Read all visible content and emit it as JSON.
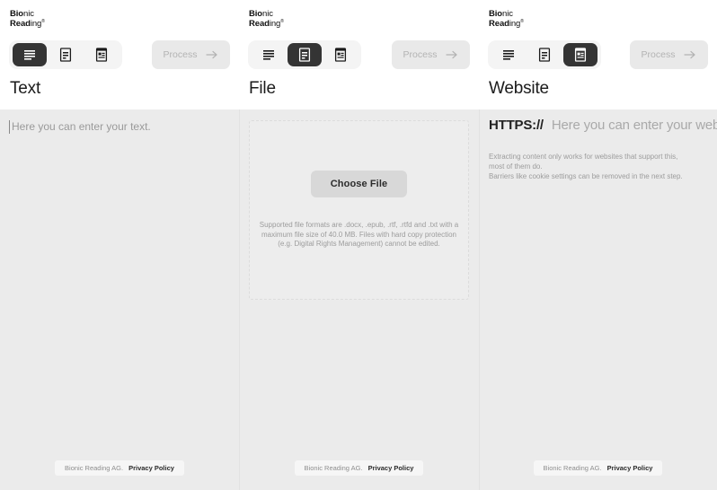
{
  "brand": {
    "line1_bold": "Bio",
    "line1_rest": "nic",
    "line2_bold": "Read",
    "line2_rest": "ing",
    "trademark": "®"
  },
  "process_button": {
    "label": "Process",
    "icon": "arrow-right-icon",
    "enabled": false
  },
  "tabs": {
    "text_icon": "text-lines-icon",
    "file_icon": "document-icon",
    "website_icon": "web-document-icon"
  },
  "panels": [
    {
      "id": "text",
      "title": "Text",
      "active_tab_index": 0,
      "input": {
        "value": "",
        "placeholder": "Here you can enter your text."
      }
    },
    {
      "id": "file",
      "title": "File",
      "active_tab_index": 1,
      "dropzone": {
        "button_label": "Choose File",
        "hint": "Supported file formats are .docx, .epub, .rtf, .rtfd and .txt with a maximum file size of 40.0 MB. Files with hard copy protection (e.g. Digital Rights Management) cannot be edited."
      }
    },
    {
      "id": "website",
      "title": "Website",
      "active_tab_index": 2,
      "url_input": {
        "scheme": "HTTPS://",
        "value": "",
        "placeholder": "Here you can enter your website l"
      },
      "hint_line_1": "Extracting content only works for websites that support this,",
      "hint_line_2": "most of them do.",
      "hint_line_3": "Barriers like cookie settings can be removed in the next step."
    }
  ],
  "footer": {
    "company": "Bionic Reading AG.",
    "privacy_label": "Privacy Policy"
  },
  "colors": {
    "active_tab_bg": "#343434",
    "panel_bg": "#ebebeb",
    "header_bg": "#ffffff",
    "process_bg": "#e9e9e9",
    "choose_file_bg": "#d8d8d8"
  }
}
